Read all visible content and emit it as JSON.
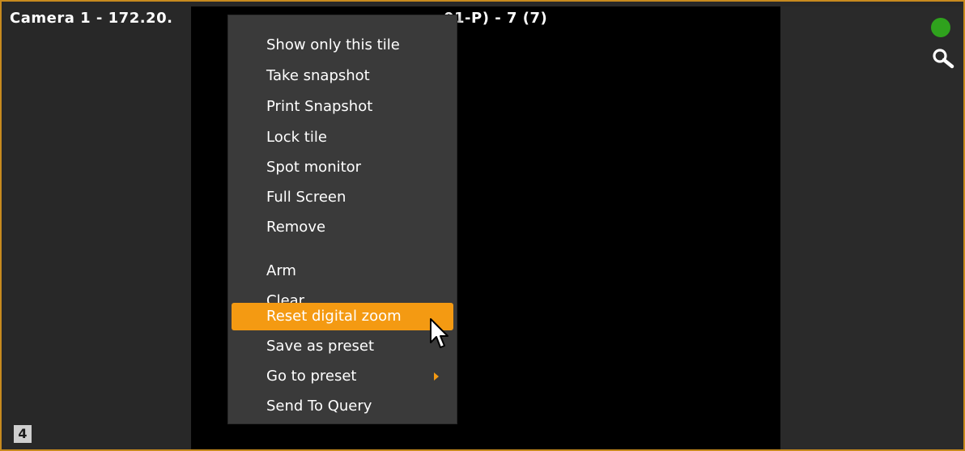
{
  "tile": {
    "title_left": "Camera 1 - 172.20.",
    "title_right": "01-P) - 7 (7)",
    "tile_number": "4",
    "status_color": "#2fa21d",
    "border_color": "#c78a1e"
  },
  "context_menu": {
    "items": [
      {
        "label": "Show only this tile"
      },
      {
        "label": "Take snapshot"
      },
      {
        "label": "Print Snapshot"
      },
      {
        "label": "Lock tile"
      },
      {
        "label": "Spot monitor"
      },
      {
        "label": "Full Screen"
      },
      {
        "label": "Remove"
      },
      {
        "label": "Arm"
      },
      {
        "label": "Clear"
      },
      {
        "label": "Reset digital zoom",
        "highlighted": true
      },
      {
        "label": "Save as preset"
      },
      {
        "label": "Go to preset",
        "submenu": true
      },
      {
        "label": "Send To Query"
      }
    ],
    "highlight_color": "#f49a12"
  },
  "icons": {
    "status": "status-dot-icon",
    "search": "search-icon",
    "cursor": "mouse-pointer-icon",
    "submenu": "submenu-arrow-icon"
  }
}
